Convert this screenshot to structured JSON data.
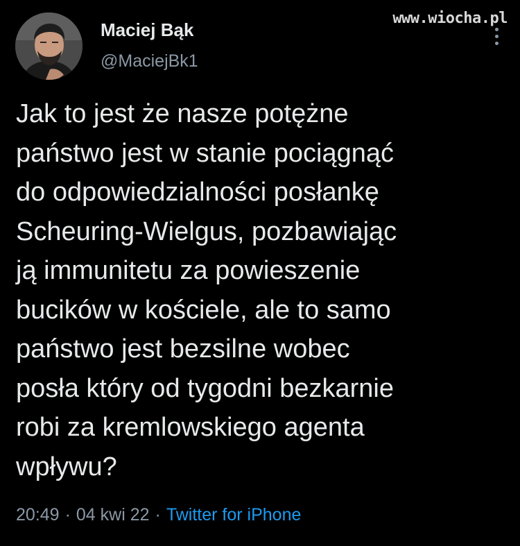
{
  "tweet": {
    "author": {
      "name": "Maciej Bąk",
      "handle": "@MaciejBk1"
    },
    "text": "Jak to jest że nasze potężne\npaństwo jest w stanie pociągnąć\ndo odpowiedzialności posłankę\nScheuring-Wielgus, pozbawiając\nją immunitetu za powieszenie\nbucików w kościele, ale to samo\npaństwo jest bezsilne wobec\nposła który od tygodni bezkarnie\nrobi za kremlowskiego agenta\nwpływu?",
    "time": "20:49",
    "date": "04 kwi 22",
    "separator": "·",
    "source": "Twitter for iPhone"
  },
  "watermark": "www.wiocha.pl",
  "icons": {
    "avatar": "profile-photo",
    "more": "more-options-icon"
  },
  "colors": {
    "background": "#000000",
    "text": "#e7e9ea",
    "secondary": "#8b98a5",
    "link": "#1d9bf0"
  }
}
